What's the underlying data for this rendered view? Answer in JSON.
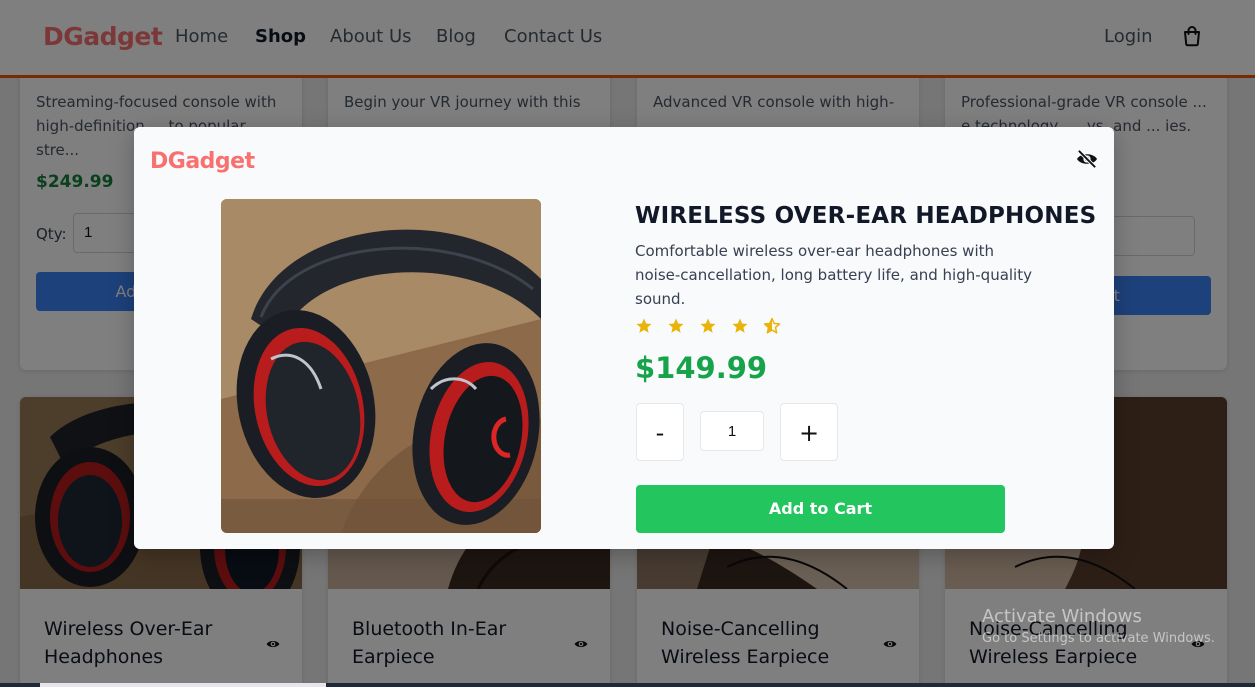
{
  "navbar": {
    "brand": "DGadget",
    "links": [
      "Home",
      "Shop",
      "About Us",
      "Blog",
      "Contact Us"
    ],
    "active": "Shop",
    "login": "Login",
    "cart_icon": "shopping-bag-icon"
  },
  "background": {
    "top_cards": [
      {
        "desc": "Streaming-focused console with high-definition ... to popular stre...",
        "price": "$249.99",
        "qty_label": "Qty:",
        "qty_value": "1",
        "button": "Add to Cart"
      },
      {
        "desc": "Begin your VR journey with this"
      },
      {
        "desc": "Advanced VR console with high-"
      },
      {
        "desc": "Professional-grade VR console ... e technology, ... ys, and ... ies.",
        "button": "rt"
      }
    ],
    "bottom_cards": [
      {
        "title": "Wireless Over-Ear Headphones",
        "icon": "eye-icon"
      },
      {
        "title": "Bluetooth In-Ear Earpiece",
        "icon": "eye-icon"
      },
      {
        "title": "Noise-Cancelling Wireless Earpiece",
        "icon": "eye-icon"
      },
      {
        "title": "Noise-Cancelling Wireless Earpiece",
        "icon": "eye-icon"
      }
    ]
  },
  "modal": {
    "brand": "DGadget",
    "close_icon": "eye-slash-icon",
    "title": "WIRELESS OVER-EAR HEADPHONES",
    "description": "Comfortable wireless over-ear headphones with noise-cancellation, long battery life, and high-quality sound.",
    "rating": 4.5,
    "price": "$149.99",
    "minus": "-",
    "quantity": "1",
    "plus": "+",
    "add_to_cart": "Add to Cart"
  },
  "watermark": {
    "line1": "Activate Windows",
    "line2": "Go to Settings to activate Windows."
  },
  "colors": {
    "brand": "#f87171",
    "nav_border": "#ea580c",
    "price_green": "#16a34a",
    "button_green": "#22c55e",
    "button_blue": "#3b82f6",
    "star": "#eab308"
  }
}
